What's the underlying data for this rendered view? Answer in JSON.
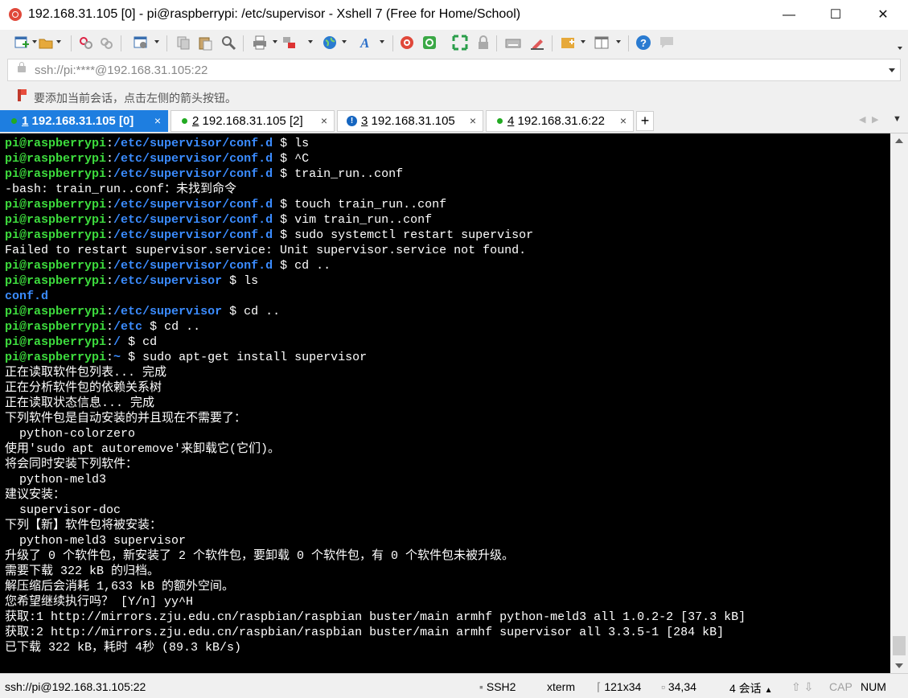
{
  "window": {
    "title": "192.168.31.105 [0] - pi@raspberrypi: /etc/supervisor - Xshell 7 (Free for Home/School)",
    "minimize": "—",
    "maximize": "☐",
    "close": "✕"
  },
  "toolbar": {
    "icons": [
      "new-session-icon",
      "open-folder-icon",
      "disconnect-icon",
      "reconnect-icon",
      "properties-icon",
      "copy-icon",
      "paste-icon",
      "find-icon",
      "print-icon",
      "transfer-icon",
      "globe-icon",
      "font-icon",
      "xshell-icon",
      "xftp-icon",
      "fullscreen-icon",
      "lock-icon",
      "keyboard-icon",
      "highlight-icon",
      "add-tab-icon",
      "layout-icon",
      "help-icon",
      "chat-icon"
    ]
  },
  "address": {
    "value": "ssh://pi:****@192.168.31.105:22"
  },
  "hint": {
    "text": "要添加当前会话，点击左侧的箭头按钮。"
  },
  "tabs": [
    {
      "num": "1",
      "label": " 192.168.31.105 [0]",
      "status": "connected",
      "close": "×"
    },
    {
      "num": "2",
      "label": " 192.168.31.105 [2]",
      "status": "connected",
      "close": "×"
    },
    {
      "num": "3",
      "label": " 192.168.31.105",
      "status": "alert",
      "close": "×"
    },
    {
      "num": "4",
      "label": " 192.168.31.6:22",
      "status": "connected",
      "close": "×"
    }
  ],
  "tab_add": "+",
  "terminal": {
    "prompt_user": "pi@raspberrypi",
    "lines": [
      {
        "path": "/etc/supervisor/conf.d",
        "sym": "$",
        "cmd": "ls"
      },
      {
        "path": "/etc/supervisor/conf.d",
        "sym": "$",
        "cmd": "^C"
      },
      {
        "path": "/etc/supervisor/conf.d",
        "sym": "$",
        "cmd": "train_run..conf"
      },
      {
        "text": "-bash: train_run..conf：未找到命令"
      },
      {
        "path": "/etc/supervisor/conf.d",
        "sym": "$",
        "cmd": "touch train_run..conf"
      },
      {
        "path": "/etc/supervisor/conf.d",
        "sym": "$",
        "cmd": "vim train_run..conf"
      },
      {
        "path": "/etc/supervisor/conf.d",
        "sym": "$",
        "cmd": "sudo systemctl restart supervisor"
      },
      {
        "text": "Failed to restart supervisor.service: Unit supervisor.service not found."
      },
      {
        "path": "/etc/supervisor/conf.d",
        "sym": "$",
        "cmd": "cd .."
      },
      {
        "path": "/etc/supervisor",
        "sym": "$",
        "cmd": "ls"
      },
      {
        "dir": "conf.d"
      },
      {
        "path": "/etc/supervisor",
        "sym": "$",
        "cmd": "cd .."
      },
      {
        "path": "/etc",
        "sym": "$",
        "cmd": "cd .."
      },
      {
        "path": "/",
        "sym": "$",
        "cmd": "cd"
      },
      {
        "path": "~",
        "sym": "$",
        "cmd": "sudo apt-get install supervisor"
      },
      {
        "text": "正在读取软件包列表... 完成"
      },
      {
        "text": "正在分析软件包的依赖关系树"
      },
      {
        "text": "正在读取状态信息... 完成"
      },
      {
        "text": "下列软件包是自动安装的并且现在不需要了："
      },
      {
        "text": "  python-colorzero"
      },
      {
        "text": "使用'sudo apt autoremove'来卸载它(它们)。"
      },
      {
        "text": "将会同时安装下列软件："
      },
      {
        "text": "  python-meld3"
      },
      {
        "text": "建议安装："
      },
      {
        "text": "  supervisor-doc"
      },
      {
        "text": "下列【新】软件包将被安装："
      },
      {
        "text": "  python-meld3 supervisor"
      },
      {
        "text": "升级了 0 个软件包，新安装了 2 个软件包，要卸载 0 个软件包，有 0 个软件包未被升级。"
      },
      {
        "text": "需要下载 322 kB 的归档。"
      },
      {
        "text": "解压缩后会消耗 1,633 kB 的额外空间。"
      },
      {
        "text": "您希望继续执行吗？ [Y/n] yy^H"
      },
      {
        "text": "获取:1 http://mirrors.zju.edu.cn/raspbian/raspbian buster/main armhf python-meld3 all 1.0.2-2 [37.3 kB]"
      },
      {
        "text": "获取:2 http://mirrors.zju.edu.cn/raspbian/raspbian buster/main armhf supervisor all 3.3.5-1 [284 kB]"
      },
      {
        "text": "已下载 322 kB，耗时 4秒 (89.3 kB/s)"
      }
    ]
  },
  "status": {
    "connection": "ssh://pi@192.168.31.105:22",
    "protocol": "SSH2",
    "term": "xterm",
    "size": "121x34",
    "cursor": "34,34",
    "sessions": "4 会话",
    "caps": "CAP",
    "num": "NUM"
  },
  "colors": {
    "prompt": "#3ddc3d",
    "directory": "#3b8cff",
    "active_tab": "#1e7ee0",
    "terminal_bg": "#000000"
  }
}
